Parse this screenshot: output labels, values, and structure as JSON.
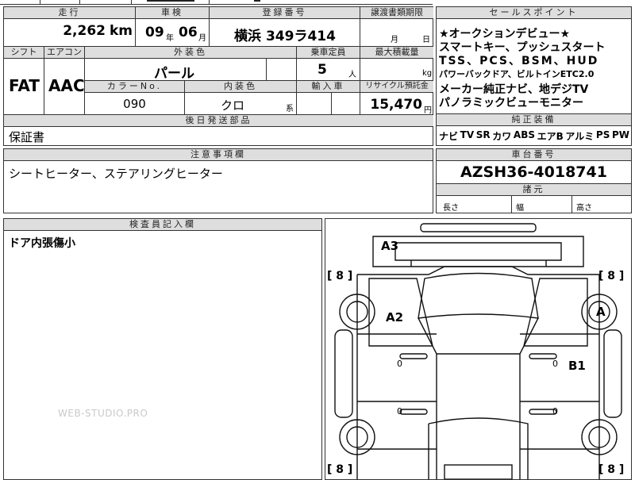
{
  "top": {
    "mileage_label": "走行",
    "inspection_label": "車検",
    "registration_label": "登録番号",
    "transfer_label": "譲渡書類期限",
    "mileage_value": "2,262",
    "mileage_unit": "km",
    "inspection_year": "09",
    "year_unit": "年",
    "inspection_month": "06",
    "month_unit": "月",
    "registration_value": "横浜 349ラ414",
    "transfer_month_unit": "月",
    "transfer_day_unit": "日"
  },
  "row2": {
    "shift_label": "シフト",
    "aircon_label": "エアコン",
    "exterior_label": "外装色",
    "capacity_label": "乗車定員",
    "loadcap_label": "最大積載量",
    "shift_value": "FAT",
    "aircon_value": "AAC",
    "exterior_value": "パール",
    "capacity_value": "5",
    "capacity_unit": "人",
    "loadcap_unit": "kg",
    "color_no_label": "カラーNo.",
    "interior_label": "内装色",
    "import_label": "輸入車",
    "recycle_label": "リサイクル預託金",
    "color_no_value": "090",
    "interior_value": "クロ",
    "interior_suffix": "系",
    "recycle_value": "15,470",
    "recycle_unit": "円"
  },
  "later_parts": {
    "label": "後日発送部品",
    "value": "保証書"
  },
  "notes": {
    "label": "注意事項欄",
    "value": "シートヒーター、ステアリングヒーター"
  },
  "inspector": {
    "label": "検査員記入欄",
    "value": "ドア内張傷小"
  },
  "sales": {
    "label": "セールスポイント",
    "lines": [
      "★オークションデビュー★",
      "スマートキー、プッシュスタート",
      "TSS、PCS、BSM、HUD",
      "パワーバックドア、ビルトインETC2.0",
      "メーカー純正ナビ、地デジTV",
      "パノラミックビューモニター"
    ]
  },
  "equipment": {
    "label": "純正装備",
    "items": [
      "ナビ",
      "TV",
      "SR",
      "カワ",
      "ABS",
      "エアB",
      "アルミ",
      "PS",
      "PW"
    ]
  },
  "chassis": {
    "label": "車台番号",
    "value": "AZSH36-4018741"
  },
  "dimensions": {
    "label": "諸元",
    "length_label": "長さ",
    "width_label": "幅",
    "height_label": "高さ"
  },
  "diagram": {
    "marks": [
      "A3",
      "A2",
      "A",
      "B1"
    ],
    "tire_marks": [
      "8",
      "8",
      "8",
      "8"
    ],
    "zeros": [
      "0",
      "0",
      "0",
      "0"
    ]
  },
  "watermark": "WEB-STUDIO.PRO"
}
